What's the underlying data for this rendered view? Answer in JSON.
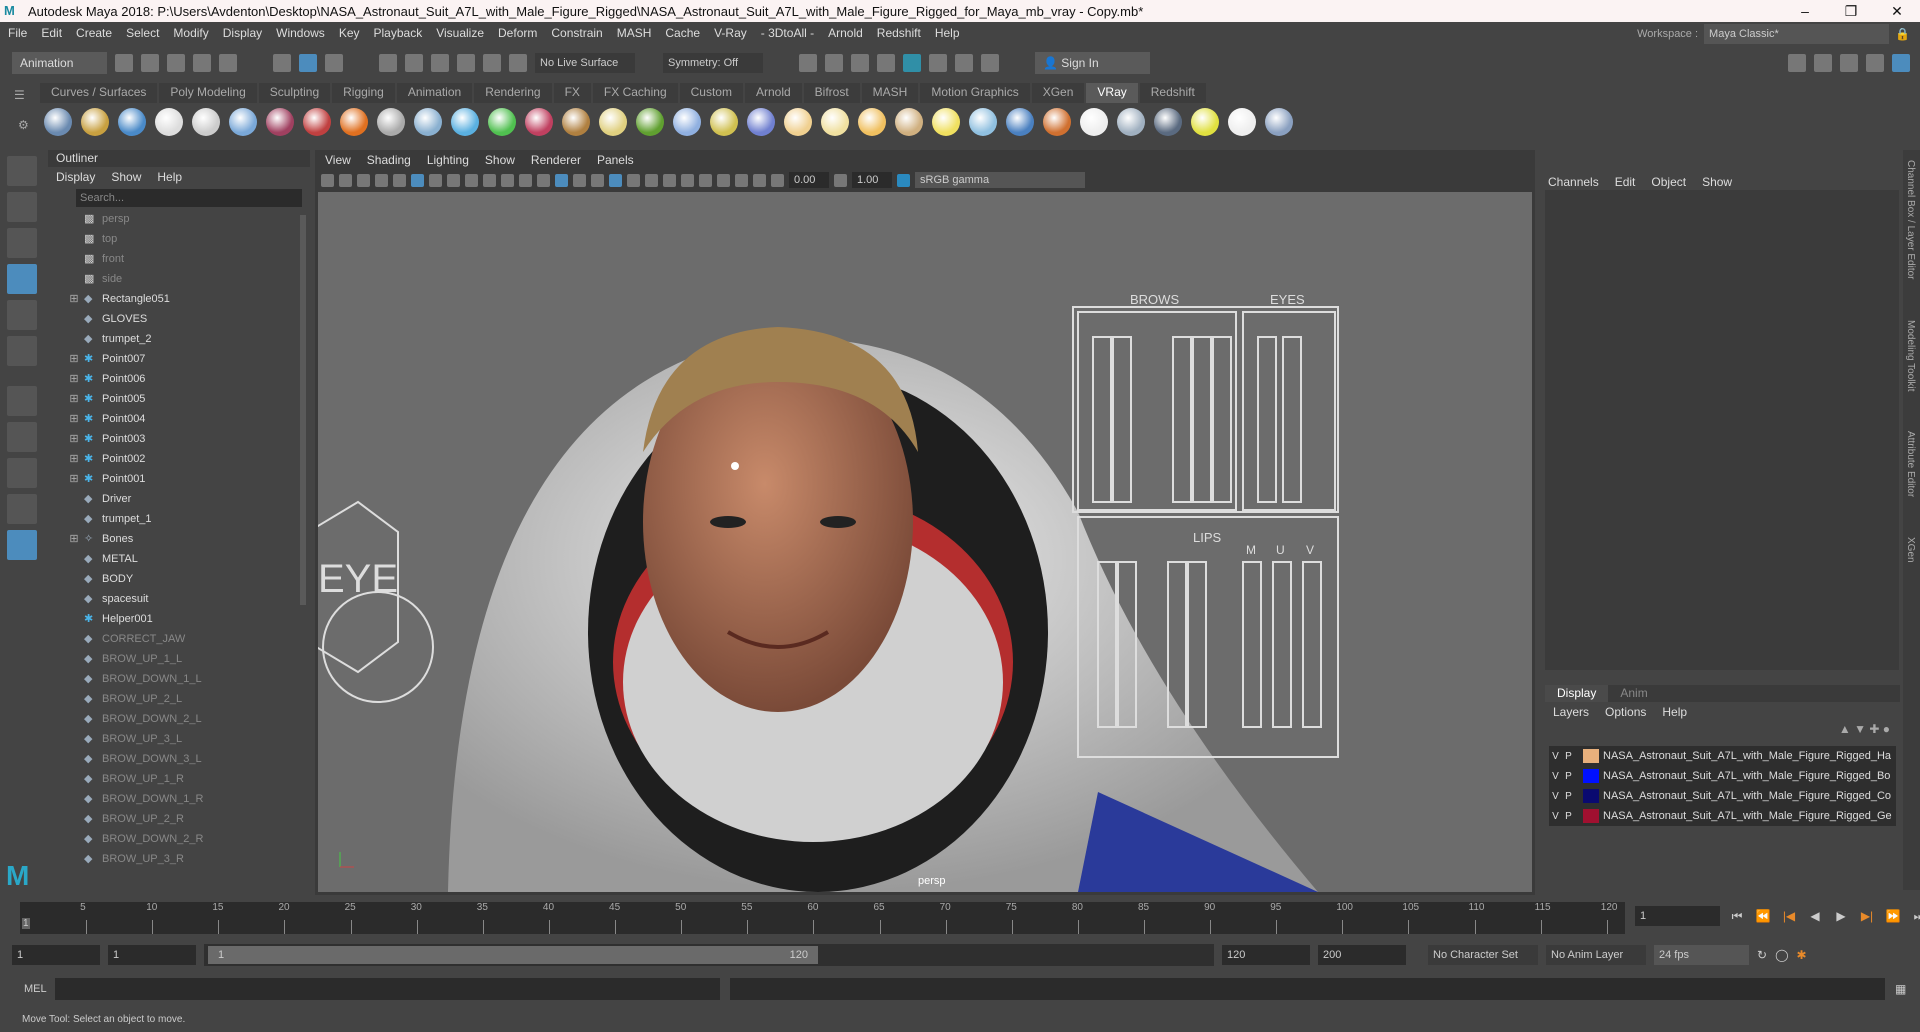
{
  "title": "Autodesk Maya 2018: P:\\Users\\Avdenton\\Desktop\\NASA_Astronaut_Suit_A7L_with_Male_Figure_Rigged\\NASA_Astronaut_Suit_A7L_with_Male_Figure_Rigged_for_Maya_mb_vray - Copy.mb*",
  "menus": [
    "File",
    "Edit",
    "Create",
    "Select",
    "Modify",
    "Display",
    "Windows",
    "Key",
    "Playback",
    "Visualize",
    "Deform",
    "Constrain",
    "MASH",
    "Cache",
    "V-Ray",
    "- 3DtoAll -",
    "Arnold",
    "Redshift",
    "Help"
  ],
  "workspace": {
    "label": "Workspace :",
    "value": "Maya Classic*"
  },
  "status": {
    "mode": "Animation",
    "live_surface": "No Live Surface",
    "symmetry": "Symmetry: Off",
    "sign_in": "Sign In"
  },
  "shelf_tabs": [
    "Curves / Surfaces",
    "Poly Modeling",
    "Sculpting",
    "Rigging",
    "Animation",
    "Rendering",
    "FX",
    "FX Caching",
    "Custom",
    "Arnold",
    "Bifrost",
    "MASH",
    "Motion Graphics",
    "XGen",
    "VRay",
    "Redshift"
  ],
  "shelf_active": "VRay",
  "outliner": {
    "title": "Outliner",
    "menus": [
      "Display",
      "Show",
      "Help"
    ],
    "search_placeholder": "Search...",
    "items": [
      {
        "label": "persp",
        "type": "cam",
        "dim": true
      },
      {
        "label": "top",
        "type": "cam",
        "dim": true
      },
      {
        "label": "front",
        "type": "cam",
        "dim": true
      },
      {
        "label": "side",
        "type": "cam",
        "dim": true
      },
      {
        "label": "Rectangle051",
        "type": "grp",
        "exp": true
      },
      {
        "label": "GLOVES",
        "type": "grp"
      },
      {
        "label": "trumpet_2",
        "type": "grp"
      },
      {
        "label": "Point007",
        "type": "pt",
        "exp": true
      },
      {
        "label": "Point006",
        "type": "pt",
        "exp": true
      },
      {
        "label": "Point005",
        "type": "pt",
        "exp": true
      },
      {
        "label": "Point004",
        "type": "pt",
        "exp": true
      },
      {
        "label": "Point003",
        "type": "pt",
        "exp": true
      },
      {
        "label": "Point002",
        "type": "pt",
        "exp": true
      },
      {
        "label": "Point001",
        "type": "pt",
        "exp": true
      },
      {
        "label": "Driver",
        "type": "grp"
      },
      {
        "label": "trumpet_1",
        "type": "grp"
      },
      {
        "label": "Bones",
        "type": "bone",
        "exp": true
      },
      {
        "label": "METAL",
        "type": "grp"
      },
      {
        "label": "BODY",
        "type": "grp"
      },
      {
        "label": "spacesuit",
        "type": "grp"
      },
      {
        "label": "Helper001",
        "type": "pt"
      },
      {
        "label": "CORRECT_JAW",
        "type": "grp",
        "dim": true
      },
      {
        "label": "BROW_UP_1_L",
        "type": "grp",
        "dim": true
      },
      {
        "label": "BROW_DOWN_1_L",
        "type": "grp",
        "dim": true
      },
      {
        "label": "BROW_UP_2_L",
        "type": "grp",
        "dim": true
      },
      {
        "label": "BROW_DOWN_2_L",
        "type": "grp",
        "dim": true
      },
      {
        "label": "BROW_UP_3_L",
        "type": "grp",
        "dim": true
      },
      {
        "label": "BROW_DOWN_3_L",
        "type": "grp",
        "dim": true
      },
      {
        "label": "BROW_UP_1_R",
        "type": "grp",
        "dim": true
      },
      {
        "label": "BROW_DOWN_1_R",
        "type": "grp",
        "dim": true
      },
      {
        "label": "BROW_UP_2_R",
        "type": "grp",
        "dim": true
      },
      {
        "label": "BROW_DOWN_2_R",
        "type": "grp",
        "dim": true
      },
      {
        "label": "BROW_UP_3_R",
        "type": "grp",
        "dim": true
      }
    ]
  },
  "viewport": {
    "menus": [
      "View",
      "Shading",
      "Lighting",
      "Show",
      "Renderer",
      "Panels"
    ],
    "exposure": "0.00",
    "gamma": "1.00",
    "color_space": "sRGB gamma",
    "camera_label": "persp",
    "rig_labels": {
      "brows": "BROWS",
      "eyes": "EYES",
      "lips": "LIPS",
      "m": "M",
      "u": "U",
      "v": "V",
      "eye": "EYE"
    }
  },
  "channel_box": {
    "menus": [
      "Channels",
      "Edit",
      "Object",
      "Show"
    ]
  },
  "side_tabs": [
    "Channel Box / Layer Editor",
    "Modeling Toolkit",
    "Attribute Editor",
    "XGen"
  ],
  "layer_editor": {
    "tabs": [
      "Display",
      "Anim"
    ],
    "menus": [
      "Layers",
      "Options",
      "Help"
    ],
    "layers": [
      {
        "v": "V",
        "p": "P",
        "name": "NASA_Astronaut_Suit_A7L_with_Male_Figure_Rigged_Ha",
        "color": "#e8b07c"
      },
      {
        "v": "V",
        "p": "P",
        "name": "NASA_Astronaut_Suit_A7L_with_Male_Figure_Rigged_Bo",
        "color": "#0010ff"
      },
      {
        "v": "V",
        "p": "P",
        "name": "NASA_Astronaut_Suit_A7L_with_Male_Figure_Rigged_Co",
        "color": "#0a0a70"
      },
      {
        "v": "V",
        "p": "P",
        "name": "NASA_Astronaut_Suit_A7L_with_Male_Figure_Rigged_Ge",
        "color": "#a01030"
      }
    ]
  },
  "timeline": {
    "ticks": [
      "5",
      "10",
      "15",
      "20",
      "25",
      "30",
      "35",
      "40",
      "45",
      "50",
      "55",
      "60",
      "65",
      "70",
      "75",
      "80",
      "85",
      "90",
      "95",
      "100",
      "105",
      "110",
      "115",
      "120"
    ],
    "current_frame": "1",
    "start_marker": "1"
  },
  "range": {
    "start": "1",
    "playback_start": "1",
    "slider_start": "1",
    "slider_end": "120",
    "playback_end": "120",
    "end": "200",
    "character_set": "No Character Set",
    "anim_layer": "No Anim Layer",
    "fps": "24 fps"
  },
  "mel": {
    "label": "MEL"
  },
  "help_line": "Move Tool: Select an object to move."
}
